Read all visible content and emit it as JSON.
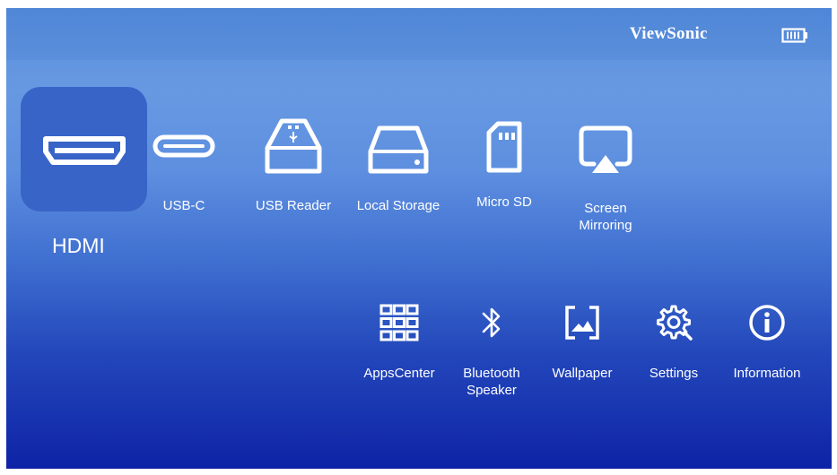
{
  "header": {
    "brand": "ViewSonic",
    "battery_icon": "battery-icon"
  },
  "sources": [
    {
      "label": "HDMI",
      "icon": "hdmi-icon",
      "selected": true
    },
    {
      "label": "USB-C",
      "icon": "usb-c-icon"
    },
    {
      "label": "USB Reader",
      "icon": "usb-reader-icon"
    },
    {
      "label": "Local Storage",
      "icon": "local-storage-icon"
    },
    {
      "label": "Micro SD",
      "icon": "micro-sd-icon"
    },
    {
      "label": "Screen\nMirroring",
      "icon": "screen-mirroring-icon"
    }
  ],
  "apps": [
    {
      "label": "AppsCenter",
      "icon": "apps-grid-icon"
    },
    {
      "label": "Bluetooth\nSpeaker",
      "icon": "bluetooth-icon"
    },
    {
      "label": "Wallpaper",
      "icon": "wallpaper-icon"
    },
    {
      "label": "Settings",
      "icon": "gear-icon"
    },
    {
      "label": "Information",
      "icon": "info-icon"
    }
  ],
  "colors": {
    "selected_tile": "#3864c8",
    "gradient_top": "#5a8fdb",
    "gradient_bottom": "#0e23a6"
  }
}
